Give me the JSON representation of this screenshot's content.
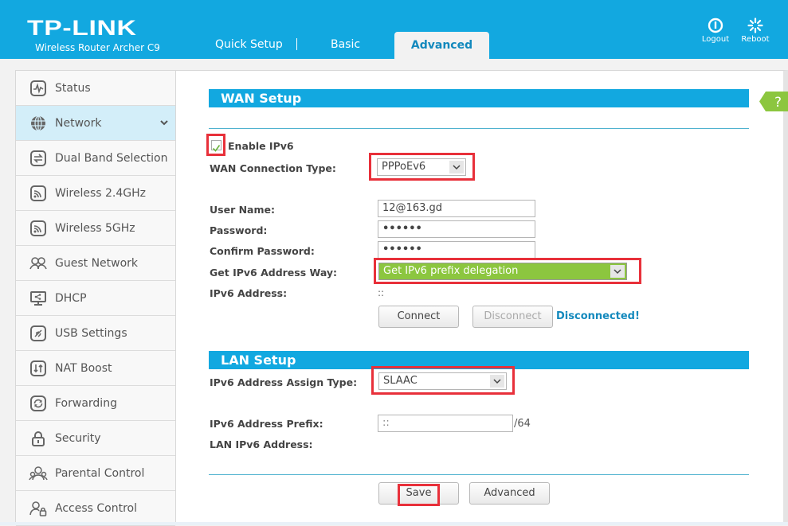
{
  "header": {
    "brand": "TP-LINK",
    "model": "Wireless Router Archer C9",
    "tabs": [
      {
        "label": "Quick Setup",
        "active": false
      },
      {
        "label": "Basic",
        "active": false
      },
      {
        "label": "Advanced",
        "active": true
      }
    ],
    "logout_label": "Logout",
    "reboot_label": "Reboot"
  },
  "sidebar": {
    "items": [
      {
        "label": "Status",
        "icon": "status-icon"
      },
      {
        "label": "Network",
        "icon": "globe-icon",
        "active": true,
        "expanded": true
      },
      {
        "label": "Dual Band Selection",
        "icon": "swap-icon"
      },
      {
        "label": "Wireless 2.4GHz",
        "icon": "wireless-icon"
      },
      {
        "label": "Wireless 5GHz",
        "icon": "wireless-icon"
      },
      {
        "label": "Guest Network",
        "icon": "guest-icon"
      },
      {
        "label": "DHCP",
        "icon": "monitor-share-icon"
      },
      {
        "label": "USB Settings",
        "icon": "usb-icon"
      },
      {
        "label": "NAT Boost",
        "icon": "updown-arrows-icon"
      },
      {
        "label": "Forwarding",
        "icon": "refresh-icon"
      },
      {
        "label": "Security",
        "icon": "lock-icon"
      },
      {
        "label": "Parental Control",
        "icon": "family-icon"
      },
      {
        "label": "Access Control",
        "icon": "user-lock-icon"
      }
    ]
  },
  "wan": {
    "title": "WAN Setup",
    "enable_ipv6_label": "Enable IPv6",
    "enable_ipv6_checked": true,
    "connection_type_label": "WAN Connection Type:",
    "connection_type_value": "PPPoEv6",
    "username_label": "User Name:",
    "username_value": "12@163.gd",
    "password_label": "Password:",
    "password_value": "••••••",
    "confirm_password_label": "Confirm Password:",
    "confirm_password_value": "••••••",
    "address_way_label": "Get IPv6 Address Way:",
    "address_way_value": "Get IPv6 prefix delegation",
    "ipv6_address_label": "IPv6 Address:",
    "ipv6_address_value": "::",
    "connect_label": "Connect",
    "disconnect_label": "Disconnect",
    "status_text": "Disconnected!"
  },
  "lan": {
    "title": "LAN Setup",
    "assign_type_label": "IPv6 Address Assign Type:",
    "assign_type_value": "SLAAC",
    "prefix_label": "IPv6 Address Prefix:",
    "prefix_value": "::",
    "prefix_suffix": "/64",
    "lan_ipv6_label": "LAN IPv6 Address:"
  },
  "footer": {
    "save_label": "Save",
    "advanced_label": "Advanced"
  },
  "help_label": "?",
  "colors": {
    "brand_blue": "#12a8e0",
    "highlight_red": "#e8303a",
    "select_green": "#8cc63f",
    "status_blue": "#1389bd"
  }
}
